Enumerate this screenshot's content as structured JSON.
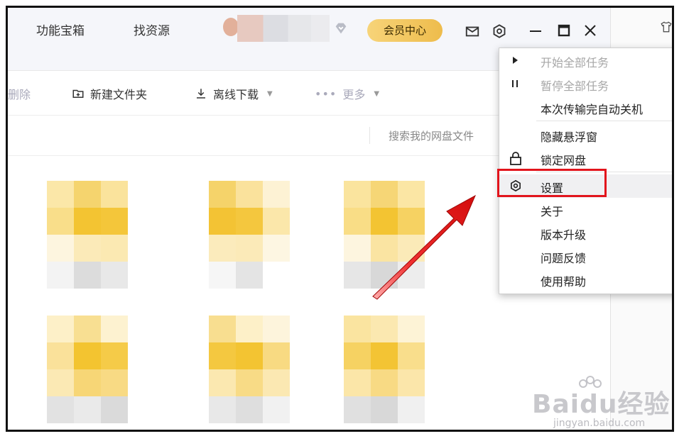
{
  "header": {
    "nav": [
      "功能宝箱",
      "找资源"
    ],
    "vip_button": "会员中心",
    "icons": [
      "mail-icon",
      "settings-icon",
      "minimize-icon",
      "maximize-icon",
      "close-icon",
      "tshirt-icon"
    ]
  },
  "toolbar": {
    "delete_label": "删除",
    "new_folder_label": "新建文件夹",
    "offline_download_label": "离线下载",
    "more_label": "更多"
  },
  "search": {
    "placeholder": "搜索我的网盘文件"
  },
  "menu": {
    "items": [
      {
        "label": "开始全部任务",
        "disabled": true,
        "icon": "play-icon"
      },
      {
        "label": "暂停全部任务",
        "disabled": true,
        "icon": "pause-icon"
      },
      {
        "label": "本次传输完自动关机",
        "disabled": false,
        "icon": ""
      },
      {
        "label": "隐藏悬浮窗",
        "disabled": false,
        "icon": ""
      },
      {
        "label": "锁定网盘",
        "disabled": false,
        "icon": "lock-icon"
      },
      {
        "label": "设置",
        "disabled": false,
        "icon": "settings-icon",
        "highlighted": true
      },
      {
        "label": "关于",
        "disabled": false,
        "icon": ""
      },
      {
        "label": "版本升级",
        "disabled": false,
        "icon": ""
      },
      {
        "label": "问题反馈",
        "disabled": false,
        "icon": ""
      },
      {
        "label": "使用帮助",
        "disabled": false,
        "icon": ""
      }
    ]
  },
  "watermark": {
    "brand": "Baidu经验",
    "site": "jingyan.baidu.com"
  },
  "colors": {
    "accent_gold": "#f0c040",
    "highlight_red": "#e2141c",
    "disabled_text": "#a7a7a7"
  }
}
